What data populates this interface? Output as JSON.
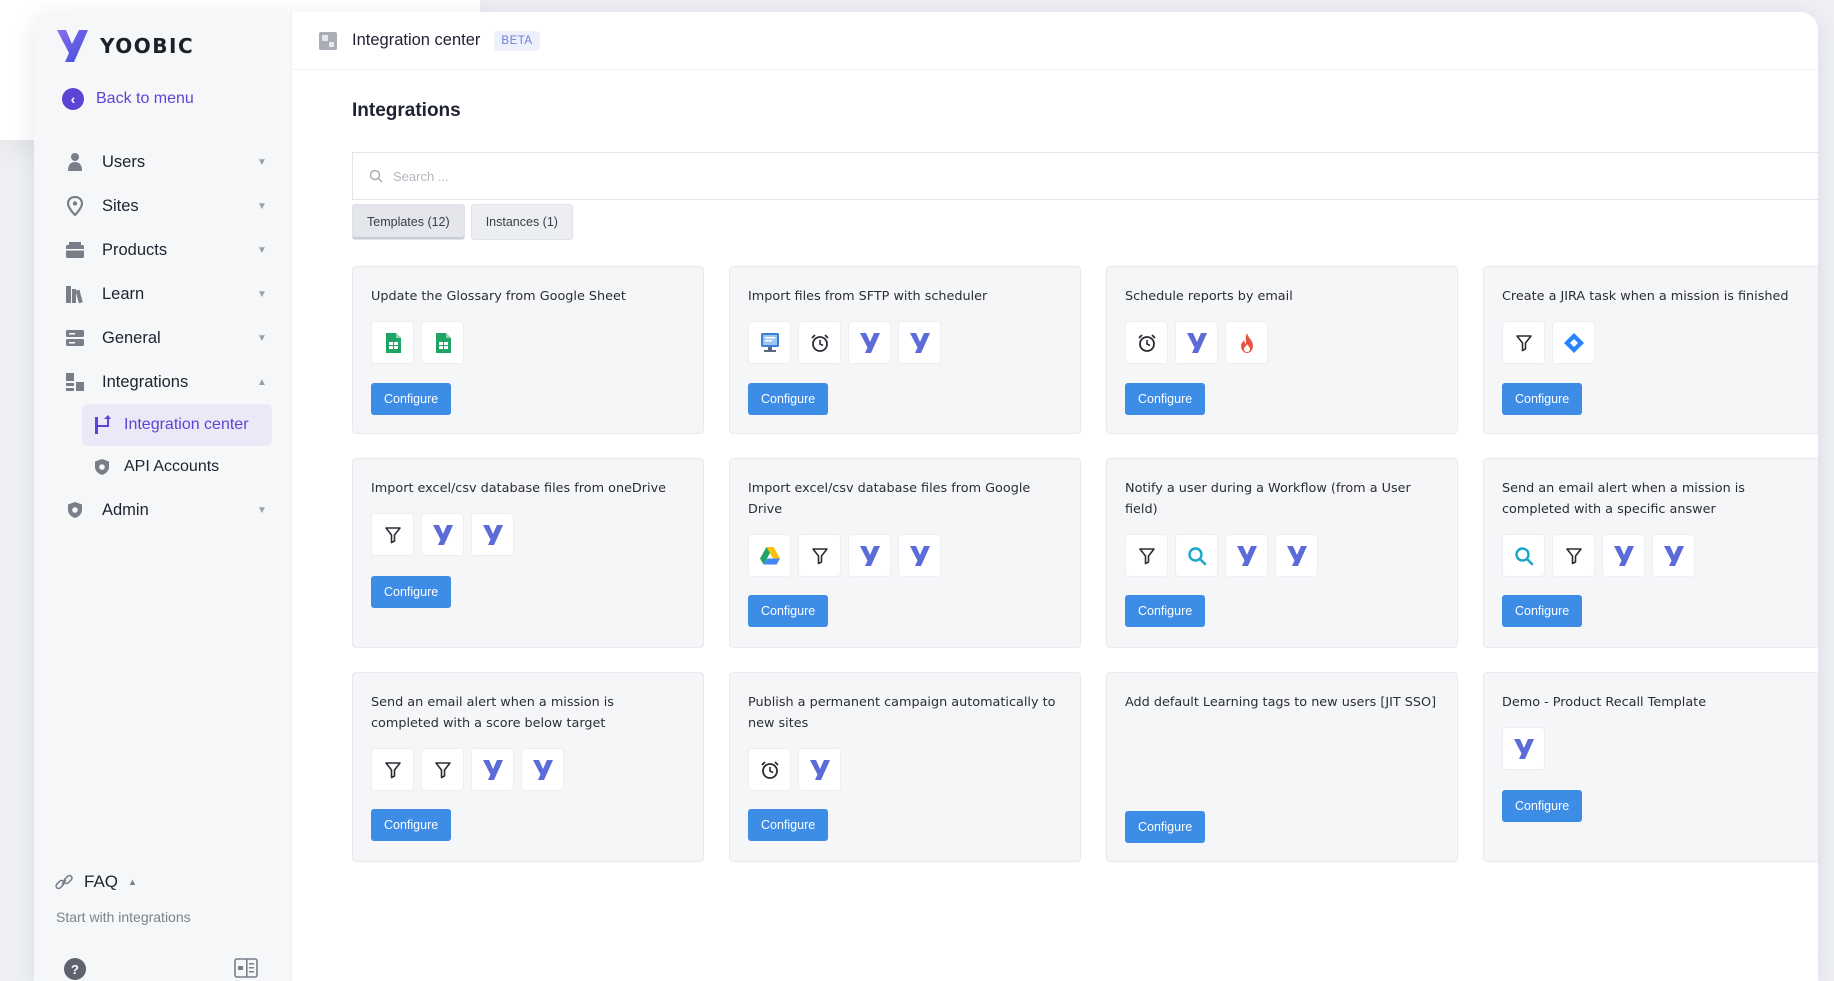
{
  "brand": {
    "name": "YOOBIC",
    "accent": "#5b45d6",
    "primary_button": "#3d8ce6"
  },
  "sidebar": {
    "back_label": "Back to menu",
    "items": [
      {
        "label": "Users",
        "icon": "user-icon"
      },
      {
        "label": "Sites",
        "icon": "location-pin-icon"
      },
      {
        "label": "Products",
        "icon": "box-icon"
      },
      {
        "label": "Learn",
        "icon": "books-icon"
      },
      {
        "label": "General",
        "icon": "settings-stack-icon"
      },
      {
        "label": "Integrations",
        "icon": "integrations-icon"
      }
    ],
    "sub_items": [
      {
        "label": "Integration center",
        "icon": "integration-center-icon"
      },
      {
        "label": "API Accounts",
        "icon": "shield-icon"
      }
    ],
    "admin_label": "Admin",
    "faq_label": "FAQ",
    "faq_sub": "Start with integrations"
  },
  "topbar": {
    "title": "Integration center",
    "badge": "BETA"
  },
  "section_title": "Integrations",
  "search": {
    "placeholder": "Search ..."
  },
  "tabs": [
    {
      "label": "Templates (12)"
    },
    {
      "label": "Instances (1)"
    }
  ],
  "configure_label": "Configure",
  "cards": [
    {
      "title": "Update the Glossary from Google Sheet",
      "icons": [
        "google-sheets-icon",
        "google-sheets-icon"
      ]
    },
    {
      "title": "Import files from SFTP with scheduler",
      "icons": [
        "sftp-server-icon",
        "alarm-clock-icon",
        "yoobic-icon",
        "yoobic-icon"
      ]
    },
    {
      "title": "Schedule reports by email",
      "icons": [
        "alarm-clock-icon",
        "yoobic-icon",
        "flame-icon"
      ]
    },
    {
      "title": "Create a JIRA task when a mission is finished",
      "icons": [
        "filter-icon",
        "jira-icon"
      ]
    },
    {
      "title": "Import excel/csv database files from oneDrive",
      "icons": [
        "filter-icon",
        "yoobic-icon",
        "yoobic-icon"
      ]
    },
    {
      "title": "Import excel/csv database files from Google Drive",
      "icons": [
        "google-drive-icon",
        "filter-icon",
        "yoobic-icon",
        "yoobic-icon"
      ]
    },
    {
      "title": "Notify a user during a Workflow (from a User field)",
      "icons": [
        "filter-icon",
        "search-icon",
        "yoobic-icon",
        "yoobic-icon"
      ]
    },
    {
      "title": "Send an email alert when a mission is completed with a specific answer",
      "icons": [
        "search-icon",
        "filter-icon",
        "yoobic-icon",
        "yoobic-icon"
      ]
    },
    {
      "title": "Send an email alert when a mission is completed with a score below target",
      "icons": [
        "filter-icon",
        "filter-icon",
        "yoobic-icon",
        "yoobic-icon"
      ]
    },
    {
      "title": "Publish a permanent campaign automatically to new sites",
      "icons": [
        "alarm-clock-icon",
        "yoobic-icon"
      ]
    },
    {
      "title": "Add default Learning tags to new users [JIT SSO]",
      "icons": []
    },
    {
      "title": "Demo - Product Recall Template",
      "icons": [
        "yoobic-icon"
      ]
    }
  ]
}
